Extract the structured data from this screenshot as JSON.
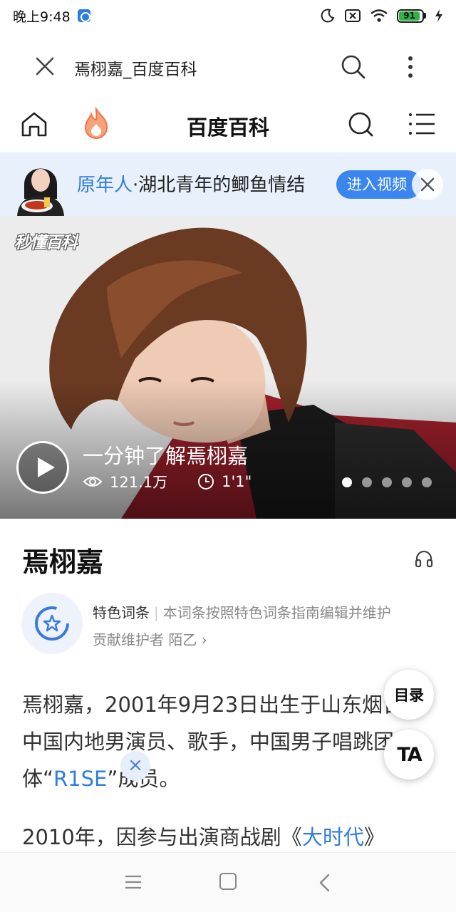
{
  "status_bar": {
    "time": "晚上9:48",
    "battery": "91",
    "icons": [
      "app-notification-icon",
      "moon-icon",
      "sim-card-icon",
      "wifi-icon",
      "battery-icon",
      "charging-icon"
    ]
  },
  "browser": {
    "title": "焉栩嘉_百度百科",
    "icons": [
      "close-icon",
      "search-icon",
      "more-vertical-icon"
    ]
  },
  "header": {
    "logo": "百度百科",
    "icons": [
      "home-icon",
      "fire-icon",
      "search-icon",
      "menu-icon"
    ]
  },
  "promo": {
    "text_highlight": "原年人",
    "text_rest": "·湖北青年的鲫鱼情结",
    "button": "进入视频"
  },
  "hero": {
    "badge": "秒懂百科",
    "video_title": "一分钟了解焉栩嘉",
    "views": "121.1万",
    "duration": "1'1\"",
    "slides_total": 5,
    "slide_active": 1
  },
  "article": {
    "title": "焉栩嘉",
    "feature_label": "特色词条",
    "feature_desc": "本词条按照特色词条指南编辑并维护",
    "contributor_label": "贡献维护者",
    "contributor_name": "陌乙",
    "para1_a": "焉栩嘉，2001年9月23日出生于山东烟台，中国内地男演员、歌手，中国男子唱跳团体“",
    "para1_link": "R1SE",
    "para1_b": "”成员。",
    "para2_a": "2010年，因参与出演商战剧《",
    "para2_link": "大时代",
    "para2_b": "》"
  },
  "floating": {
    "toc": "目录",
    "text_size": "TA",
    "close": "×"
  },
  "colors": {
    "accent_blue": "#2e7de0",
    "promo_bg": "#e8f0fb",
    "battery_green": "#2fb344"
  }
}
